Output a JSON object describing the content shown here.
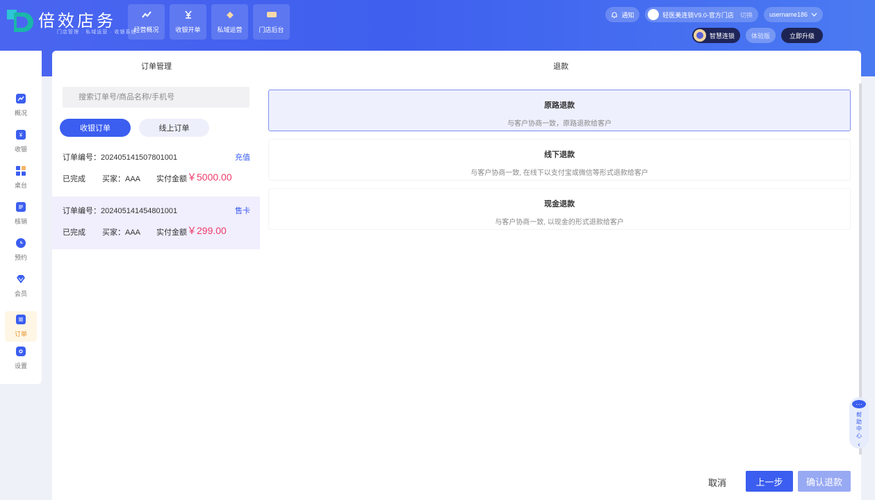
{
  "header": {
    "brand": "倍效店务",
    "brand_sub": "门店管理 · 私域运营 · 收银系统",
    "nav": [
      {
        "label": "经营概况",
        "icon": "trend-icon"
      },
      {
        "label": "收银开单",
        "icon": "yen-icon"
      },
      {
        "label": "私域运营",
        "icon": "diamond-icon"
      },
      {
        "label": "门店后台",
        "icon": "card-icon"
      }
    ],
    "notify_label": "通知",
    "store_name": "轻医美连锁V9.0-官方门店",
    "switch_label": "切换",
    "username": "username186",
    "plan_label": "智慧连锁",
    "trial_label": "体验版",
    "upgrade_label": "立即升级"
  },
  "sidebar": {
    "items": [
      {
        "label": "概况",
        "icon": "chart-icon"
      },
      {
        "label": "收银",
        "icon": "yen-icon"
      },
      {
        "label": "桌台",
        "icon": "table-icon"
      },
      {
        "label": "核销",
        "icon": "verify-icon"
      },
      {
        "label": "预约",
        "icon": "clock-icon"
      },
      {
        "label": "会员",
        "icon": "diamond-icon"
      },
      {
        "label": "订单",
        "icon": "order-icon"
      },
      {
        "label": "设置",
        "icon": "gear-icon"
      }
    ],
    "active": "订单"
  },
  "left": {
    "title": "订单管理",
    "search_placeholder": "搜索订单号/商品名称/手机号",
    "tab_on": "收银订单",
    "tab_off": "线上订单",
    "orders": [
      {
        "no": "订单编号：202405141507801001",
        "tag": "充值",
        "status": "已完成",
        "buyer": "买家：AAA",
        "amount_label": "实付金额",
        "amount": "￥5000.00"
      },
      {
        "no": "订单编号：202405141454801001",
        "tag": "售卡",
        "status": "已完成",
        "buyer": "买家：AAA",
        "amount_label": "实付金额",
        "amount": "￥299.00"
      }
    ]
  },
  "right": {
    "title": "退款",
    "options": [
      {
        "title": "原路退款",
        "desc": "与客户协商一致，原路退款给客户"
      },
      {
        "title": "线下退款",
        "desc": "与客户协商一致, 在线下以支付宝或微信等形式退款给客户"
      },
      {
        "title": "现金退款",
        "desc": "与客户协商一致, 以现金的形式退款给客户"
      }
    ],
    "cancel": "取消",
    "prev": "上一步",
    "confirm": "确认退款"
  },
  "help": {
    "label": "帮助中心"
  },
  "colors": {
    "accent": "#3b5ef0",
    "amount": "#ee3b6c",
    "active_side": "#e6982e"
  }
}
